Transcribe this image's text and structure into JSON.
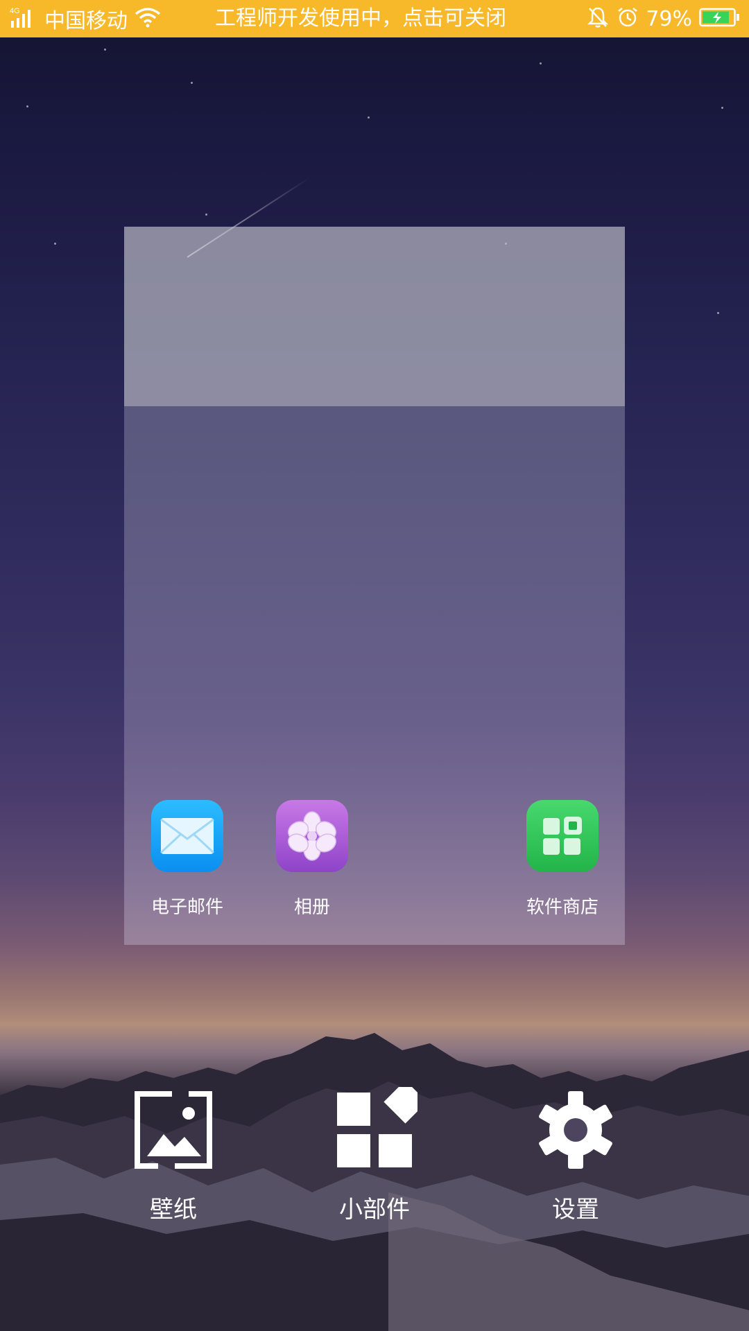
{
  "status_bar": {
    "network_type": "4G",
    "carrier": "中国移动",
    "notice": "工程师开发使用中，点击可关闭",
    "battery_percent": "79%",
    "bar_color": "#f7b829"
  },
  "preview": {
    "apps": [
      {
        "label": "电子邮件",
        "icon": "mail-icon",
        "color": "#1aa6f7"
      },
      {
        "label": "相册",
        "icon": "gallery-flower-icon",
        "color": "#a65ad8"
      },
      {
        "label": "软件商店",
        "icon": "app-store-icon",
        "color": "#34c759"
      }
    ]
  },
  "actions": [
    {
      "label": "壁纸",
      "icon": "wallpaper-icon"
    },
    {
      "label": "小部件",
      "icon": "widgets-icon"
    },
    {
      "label": "设置",
      "icon": "gear-icon"
    }
  ]
}
